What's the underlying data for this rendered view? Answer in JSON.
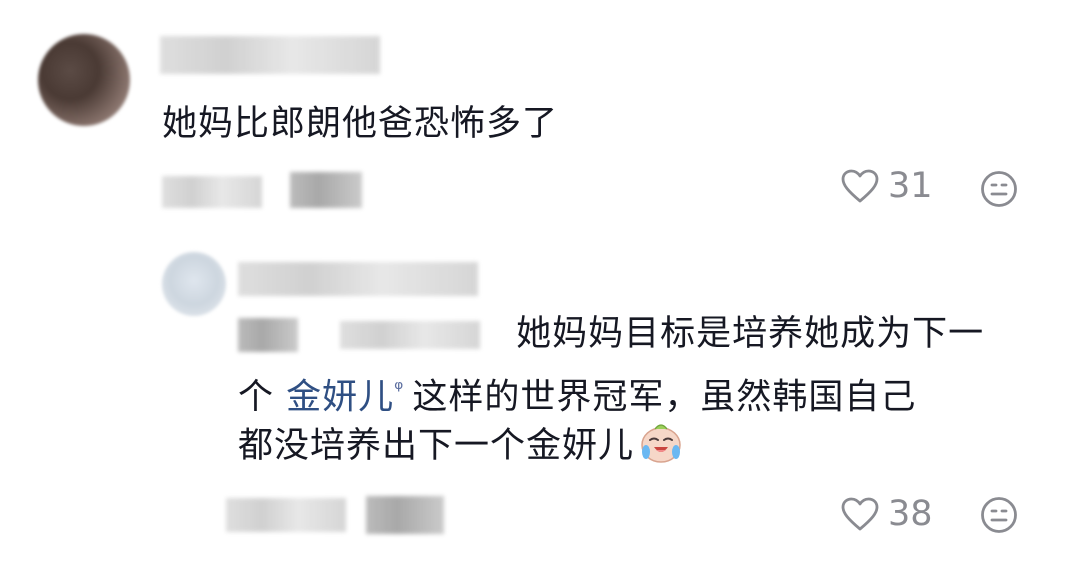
{
  "comment": {
    "text": "她妈比郎朗他爸恐怖多了",
    "like_count": "31",
    "like_icon": "heart-outline-icon",
    "dislike_icon": "meh-face-icon"
  },
  "reply": {
    "line1_text": "她妈妈目标是培养她成为下一",
    "line2_prefix": "个 ",
    "line2_mention": "金妍儿",
    "line2_search_glyph": "ᵠ",
    "line2_suffix": "这样的世界冠军，虽然韩国自己",
    "line3_text": "都没培养出下一个金妍儿",
    "emoji": "crying-laughing-face-emoji",
    "like_count": "38",
    "like_icon": "heart-outline-icon",
    "dislike_icon": "meh-face-icon"
  },
  "colors": {
    "text": "#161823",
    "secondary": "#8a8b91",
    "mention": "#2f4f83"
  }
}
